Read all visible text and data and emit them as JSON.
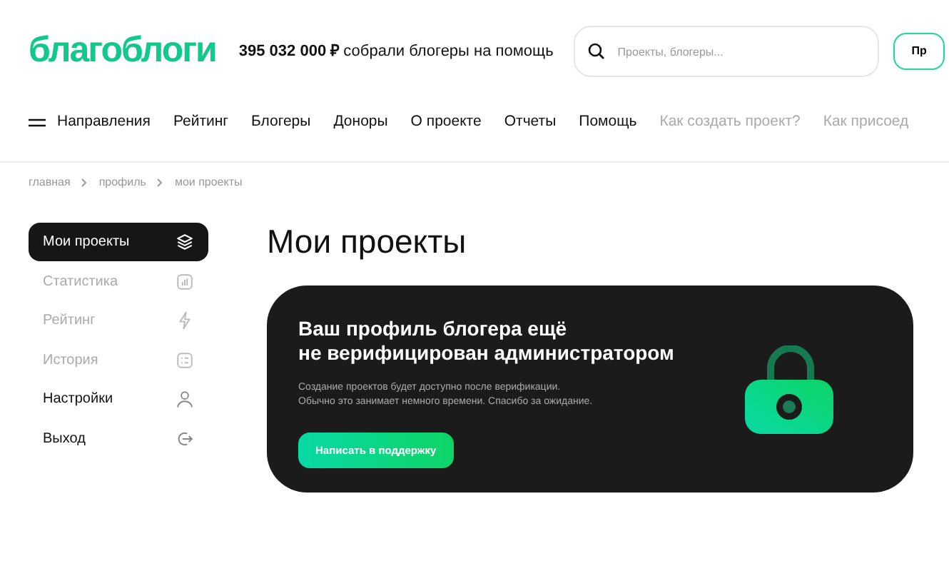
{
  "header": {
    "logo": "благоблоги",
    "raised_amount": "395 032 000 ₽",
    "raised_text": "собрали блогеры на помощь",
    "search": {
      "placeholder": "Проекты, блогеры..."
    },
    "button": "Пр"
  },
  "nav": [
    {
      "label": "Направления",
      "kind": "menu"
    },
    {
      "label": "Рейтинг",
      "kind": "main"
    },
    {
      "label": "Блогеры",
      "kind": "main"
    },
    {
      "label": "Доноры",
      "kind": "main"
    },
    {
      "label": "О проекте",
      "kind": "main"
    },
    {
      "label": "Отчеты",
      "kind": "main"
    },
    {
      "label": "Помощь",
      "kind": "main"
    },
    {
      "label": "Как создать проект?",
      "kind": "secondary"
    },
    {
      "label": "Как присоед",
      "kind": "secondary"
    }
  ],
  "breadcrumbs": [
    "главная",
    "профиль",
    "мои проекты"
  ],
  "sidebar": {
    "items": [
      {
        "label": "Мои проекты",
        "selected": true,
        "disabled": false
      },
      {
        "label": "Статистика",
        "selected": false,
        "disabled": true
      },
      {
        "label": "Рейтинг",
        "selected": false,
        "disabled": true
      },
      {
        "label": "История",
        "selected": false,
        "disabled": true
      },
      {
        "label": "Настройки",
        "selected": false,
        "disabled": false
      },
      {
        "label": "Выход",
        "selected": false,
        "disabled": false
      }
    ]
  },
  "page_title": "Мои проекты",
  "notice": {
    "title_line_1": "Ваш профиль блогера ещё",
    "title_line_2": "не верифицирован администратором",
    "text_line_1": "Создание проектов будет доступно после верификации.",
    "text_line_2": "Обычно это занимает немного времени. Спасибо за ожидание.",
    "button": "Написать в поддержку"
  }
}
